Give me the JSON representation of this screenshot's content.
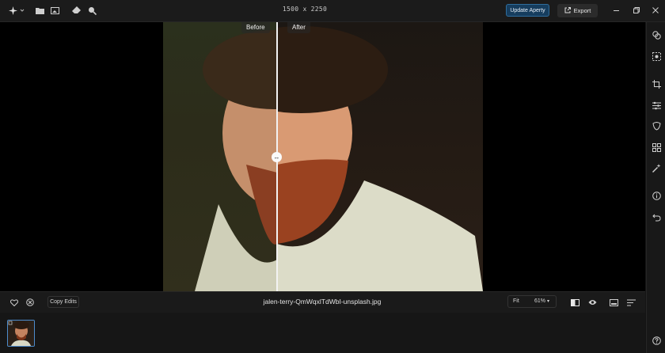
{
  "toolbar": {
    "image_dimensions": "1500 x 2250",
    "update_label": "Update Aperty",
    "export_label": "Export"
  },
  "compare": {
    "before_label": "Before",
    "after_label": "After",
    "split_position": 0.36
  },
  "bottom": {
    "copy_edits_label": "Copy Edits",
    "filename": "jalen-terry-QmWqxlTdWbI-unsplash.jpg",
    "fit_label": "Fit",
    "zoom_label": "61%"
  },
  "colors": {
    "accent": "#2f6d9c",
    "update_button_bg": "#163d5e",
    "thumbnail_border": "#4d8ccc"
  }
}
